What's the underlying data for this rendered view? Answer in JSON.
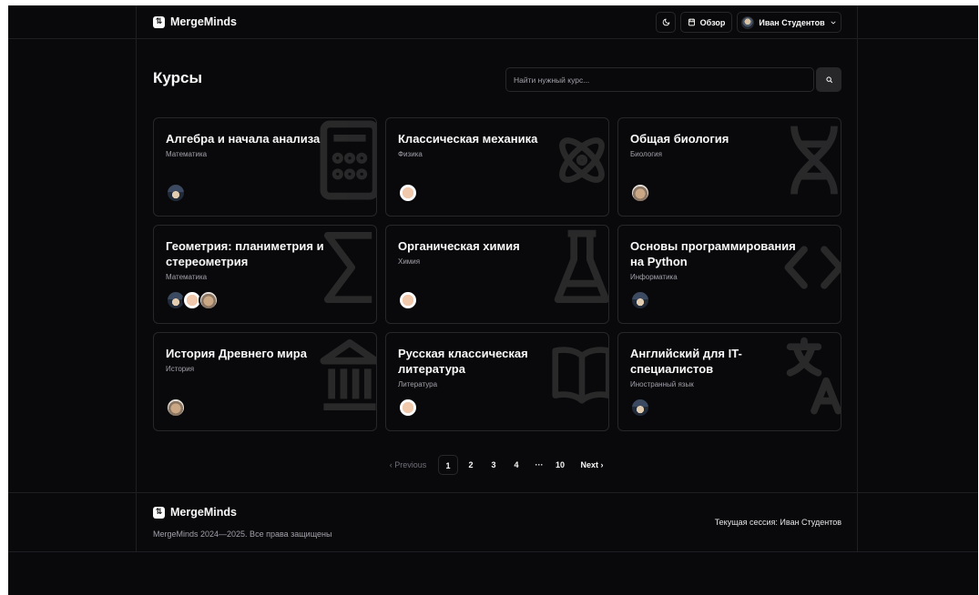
{
  "app": {
    "brand": "MergeMinds",
    "logo_glyph": "⇅"
  },
  "header": {
    "theme_toggle_icon": "moon-icon",
    "overview_label": "Обзор",
    "overview_icon": "calendar-icon",
    "user_name": "Иван Студентов",
    "user_menu_icon": "chevron-down-icon"
  },
  "page": {
    "title": "Курсы",
    "search_placeholder": "Найти нужный курс...",
    "search_icon": "search-icon"
  },
  "courses": [
    {
      "title": "Алгебра и начала анализа",
      "subject": "Математика",
      "bg_icon": "calculator-icon",
      "avatars": [
        "blue"
      ]
    },
    {
      "title": "Классическая механика",
      "subject": "Физика",
      "bg_icon": "atom-icon",
      "avatars": [
        "bald"
      ]
    },
    {
      "title": "Общая биология",
      "subject": "Биология",
      "bg_icon": "dna-icon",
      "avatars": [
        "cat"
      ]
    },
    {
      "title": "Геометрия: планиметрия и стереометрия",
      "subject": "Математика",
      "bg_icon": "sigma-icon",
      "avatars": [
        "blue",
        "bald",
        "cat"
      ]
    },
    {
      "title": "Органическая химия",
      "subject": "Химия",
      "bg_icon": "flask-icon",
      "avatars": [
        "bald"
      ]
    },
    {
      "title": "Основы программирования на Python",
      "subject": "Информатика",
      "bg_icon": "code-icon",
      "avatars": [
        "blue"
      ]
    },
    {
      "title": "История Древнего мира",
      "subject": "История",
      "bg_icon": "landmark-icon",
      "avatars": [
        "cat"
      ]
    },
    {
      "title": "Русская классическая литература",
      "subject": "Литература",
      "bg_icon": "book-icon",
      "avatars": [
        "bald"
      ]
    },
    {
      "title": "Английский для IT-специалистов",
      "subject": "Иностранный язык",
      "bg_icon": "translate-icon",
      "avatars": [
        "blue"
      ]
    }
  ],
  "pagination": {
    "previous": "‹  Previous",
    "pages": [
      "1",
      "2",
      "3",
      "4"
    ],
    "ellipsis": "···",
    "last": "10",
    "next": "Next  ›",
    "current": "1"
  },
  "footer": {
    "brand": "MergeMinds",
    "copyright": "MergeMinds 2024—2025. Все права защищены",
    "session": "Текущая сессия: Иван Студентов"
  },
  "colors": {
    "background": "#09090b",
    "border": "#27272a",
    "text": "#fafafa",
    "muted": "#a1a1aa"
  }
}
